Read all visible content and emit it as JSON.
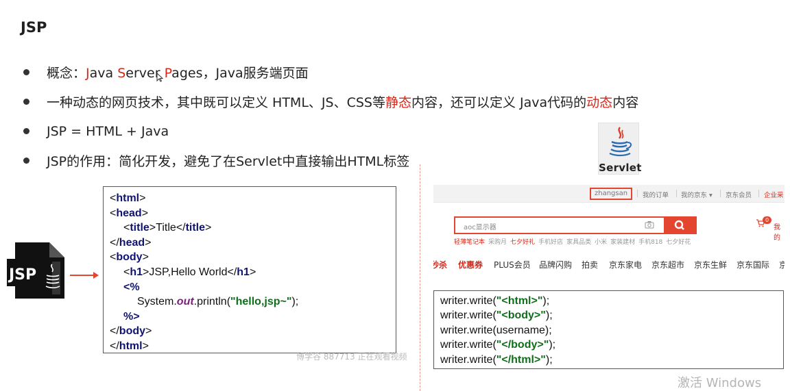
{
  "title": "JSP",
  "bullets": [
    {
      "parts": [
        {
          "t": "概念：",
          "red": false
        },
        {
          "t": "J",
          "red": true
        },
        {
          "t": "ava ",
          "red": false
        },
        {
          "t": "S",
          "red": true
        },
        {
          "t": "erver ",
          "red": false
        },
        {
          "t": "P",
          "red": true
        },
        {
          "t": "ages，Java服务端页面",
          "red": false
        }
      ]
    },
    {
      "parts": [
        {
          "t": "一种动态的网页技术，其中既可以定义 HTML、JS、CSS等",
          "red": false
        },
        {
          "t": "静态",
          "red": true
        },
        {
          "t": "内容，还可以定义 Java代码的",
          "red": false
        },
        {
          "t": "动态",
          "red": true
        },
        {
          "t": "内容",
          "red": false
        }
      ]
    },
    {
      "parts": [
        {
          "t": "JSP = HTML + Java",
          "red": false
        }
      ]
    },
    {
      "parts": [
        {
          "t": "JSP的作用：简化开发，避免了在Servlet中直接输出HTML标签",
          "red": false
        }
      ]
    }
  ],
  "servlet_logo_label": "Servlet",
  "jsp_icon_label": "JSP",
  "jsp_code": [
    {
      "indent": 0,
      "parts": [
        {
          "t": "<"
        },
        {
          "t": "html",
          "c": "tag"
        },
        {
          "t": ">"
        }
      ]
    },
    {
      "indent": 0,
      "parts": [
        {
          "t": "<"
        },
        {
          "t": "head",
          "c": "tag"
        },
        {
          "t": ">"
        }
      ]
    },
    {
      "indent": 1,
      "parts": [
        {
          "t": "<"
        },
        {
          "t": "title",
          "c": "tag"
        },
        {
          "t": ">Title</"
        },
        {
          "t": "title",
          "c": "tag"
        },
        {
          "t": ">"
        }
      ]
    },
    {
      "indent": 0,
      "parts": [
        {
          "t": "</"
        },
        {
          "t": "head",
          "c": "tag"
        },
        {
          "t": ">"
        }
      ]
    },
    {
      "indent": 0,
      "parts": [
        {
          "t": "<"
        },
        {
          "t": "body",
          "c": "tag"
        },
        {
          "t": ">"
        }
      ]
    },
    {
      "indent": 1,
      "parts": [
        {
          "t": "<"
        },
        {
          "t": "h1",
          "c": "tag"
        },
        {
          "t": ">JSP,Hello World</"
        },
        {
          "t": "h1",
          "c": "tag"
        },
        {
          "t": ">"
        }
      ]
    },
    {
      "indent": 1,
      "parts": [
        {
          "t": "<%",
          "c": "kw"
        }
      ]
    },
    {
      "indent": 2,
      "parts": [
        {
          "t": "System."
        },
        {
          "t": "out",
          "c": "out"
        },
        {
          "t": ".println("
        },
        {
          "t": "\"hello,jsp~\"",
          "c": "str"
        },
        {
          "t": ");"
        }
      ]
    },
    {
      "indent": 1,
      "parts": [
        {
          "t": "%>",
          "c": "kw"
        }
      ]
    },
    {
      "indent": 0,
      "parts": [
        {
          "t": "</"
        },
        {
          "t": "body",
          "c": "tag"
        },
        {
          "t": ">"
        }
      ]
    },
    {
      "indent": 0,
      "parts": [
        {
          "t": "</"
        },
        {
          "t": "html",
          "c": "tag"
        },
        {
          "t": ">"
        }
      ]
    }
  ],
  "watermark": "博学谷 887713 正在观看视频",
  "jd": {
    "username": "zhangsan",
    "top_links": [
      "我的订单",
      "我的京东 ▾",
      "京东会员",
      "企业采"
    ],
    "search_placeholder": "aoc显示器",
    "hot_words": [
      {
        "t": "轻薄笔记本",
        "red": true
      },
      {
        "t": "采购月",
        "red": false
      },
      {
        "t": "七夕好礼",
        "red": true
      },
      {
        "t": "手机好店",
        "red": false
      },
      {
        "t": "家具品类",
        "red": false
      },
      {
        "t": "小米",
        "red": false
      },
      {
        "t": "家装建材",
        "red": false
      },
      {
        "t": "手机818",
        "red": false
      },
      {
        "t": "七夕好花",
        "red": false
      }
    ],
    "cart_count": "0",
    "cart_text": "我的",
    "nav": [
      {
        "t": "秒杀",
        "red": true
      },
      {
        "t": "优惠券",
        "red": true
      },
      {
        "t": "PLUS会员",
        "red": false
      },
      {
        "t": "品牌闪购",
        "red": false
      },
      {
        "t": "拍卖",
        "red": false
      },
      {
        "t": "京东家电",
        "red": false
      },
      {
        "t": "京东超市",
        "red": false
      },
      {
        "t": "京东生鲜",
        "red": false
      },
      {
        "t": "京东国际",
        "red": false
      },
      {
        "t": "京",
        "red": false
      }
    ]
  },
  "servlet_code": [
    [
      {
        "t": "writer.write("
      },
      {
        "t": "\"<html>\"",
        "c": "str"
      },
      {
        "t": ");"
      }
    ],
    [
      {
        "t": "writer.write("
      },
      {
        "t": "\"<body>\"",
        "c": "str"
      },
      {
        "t": ");"
      }
    ],
    [
      {
        "t": "writer.write(username);"
      }
    ],
    [
      {
        "t": "writer.write("
      },
      {
        "t": "\"</body>\"",
        "c": "str"
      },
      {
        "t": ");"
      }
    ],
    [
      {
        "t": "writer.write("
      },
      {
        "t": "\"</html>\"",
        "c": "str"
      },
      {
        "t": ");"
      }
    ]
  ],
  "activate_text": "激活 Windows"
}
